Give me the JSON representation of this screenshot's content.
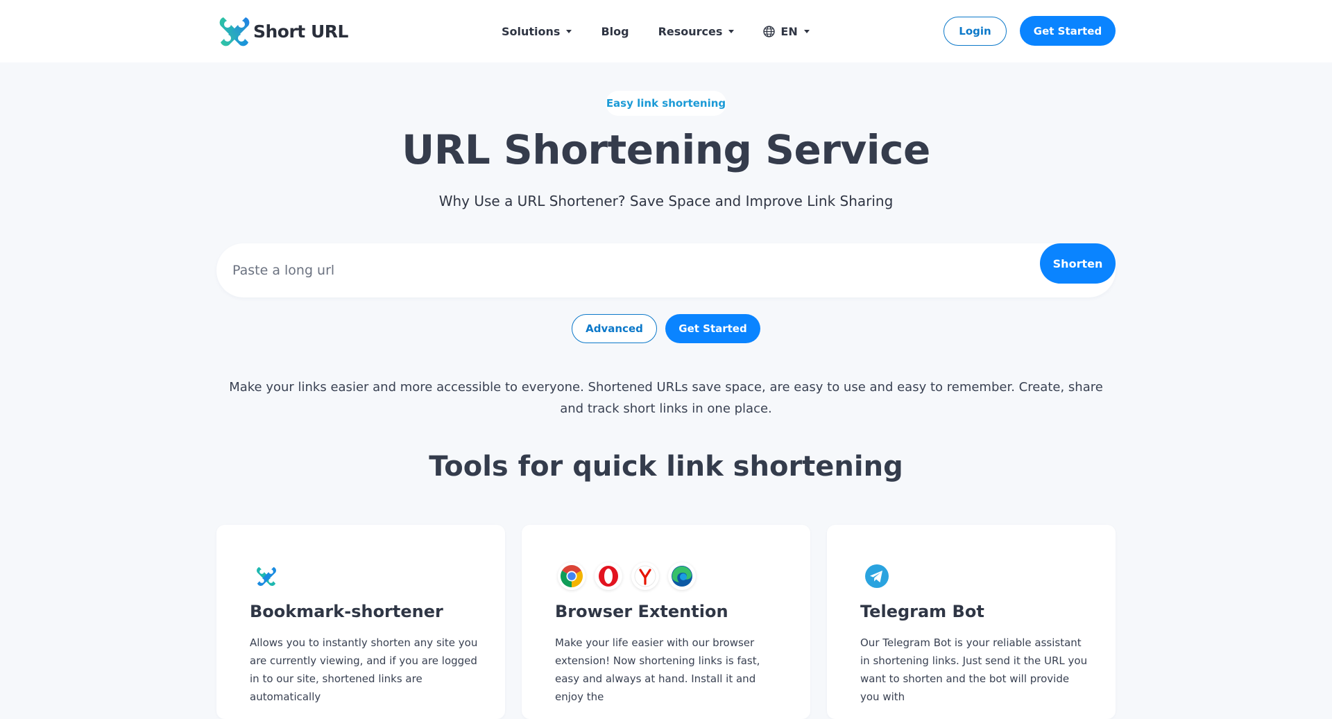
{
  "nav": {
    "brand": "Short URL",
    "items": [
      {
        "label": "Solutions",
        "dropdown": true
      },
      {
        "label": "Blog",
        "dropdown": false
      },
      {
        "label": "Resources",
        "dropdown": true
      }
    ],
    "language": "EN",
    "login_label": "Login",
    "get_started_label": "Get Started"
  },
  "hero": {
    "badge": "Easy link shortening",
    "title": "URL Shortening Service",
    "subtitle": "Why Use a URL Shortener? Save Space and Improve Link Sharing",
    "input_placeholder": "Paste a long url",
    "shorten_label": "Shorten",
    "advanced_label": "Advanced",
    "get_started_label": "Get Started",
    "description": "Make your links easier and more accessible to everyone. Shortened URLs save space, are easy to use and easy to remember. Create, share and track short links in one place."
  },
  "tools": {
    "title": "Tools for quick link shortening",
    "cards": [
      {
        "icons": [
          "short-url-logo-icon"
        ],
        "title": "Bookmark-shortener",
        "text": "Allows you to instantly shorten any site you are currently viewing, and if you are logged in to our site, shortened links are automatically"
      },
      {
        "icons": [
          "chrome-icon",
          "opera-icon",
          "yandex-icon",
          "edge-icon"
        ],
        "title": "Browser Extention",
        "text": "Make your life easier with our browser extension! Now shortening links is fast, easy and always at hand. Install it and enjoy the"
      },
      {
        "icons": [
          "telegram-icon"
        ],
        "title": "Telegram Bot",
        "text": "Our Telegram Bot is your reliable assistant in shortening links. Just send it the URL you want to shorten and the bot will provide you with"
      }
    ]
  },
  "colors": {
    "primary": "#0a84ff",
    "outline": "#0b78c9",
    "badge_text": "#1b9ad6",
    "background": "#f6f8fb"
  }
}
